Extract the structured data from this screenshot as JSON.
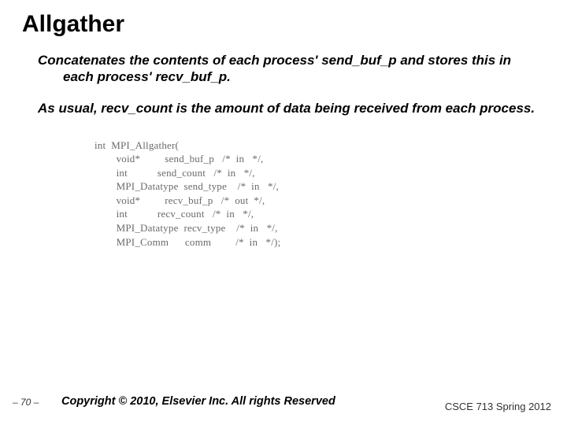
{
  "title": "Allgather",
  "para1": "Concatenates the contents of each process' send_buf_p and stores this in each process' recv_buf_p.",
  "para2": "As usual, recv_count is the amount of data being received from each process.",
  "code": "int  MPI_Allgather(\n        void*         send_buf_p   /*  in   */,\n        int           send_count   /*  in   */,\n        MPI_Datatype  send_type    /*  in   */,\n        void*         recv_buf_p   /*  out  */,\n        int           recv_count   /*  in   */,\n        MPI_Datatype  recv_type    /*  in   */,\n        MPI_Comm      comm         /*  in   */);",
  "footer": {
    "pageno": "– 70 –",
    "copyright": "Copyright © 2010, Elsevier Inc. All rights Reserved",
    "course": "CSCE 713 Spring 2012"
  }
}
